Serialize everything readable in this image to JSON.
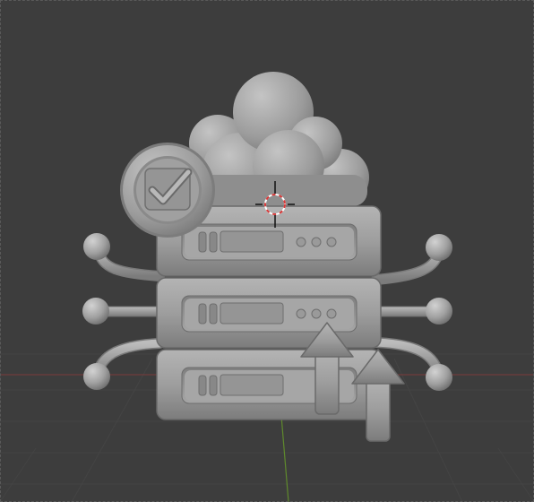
{
  "viewport": {
    "background": "#3d3d3d",
    "grid_color": "#474747",
    "x_axis_color": "#7a3c3c",
    "y_axis_color": "#5f8a2c",
    "model_color": "#9e9e9e"
  },
  "model": {
    "name": "cloud-server-upload",
    "server_units": 3,
    "parts": [
      "cloud",
      "check-badge",
      "server-rack",
      "network-nodes",
      "upload-arrows"
    ]
  },
  "overlay": {
    "cursor": "3d-cursor",
    "origin": "object-origin"
  }
}
